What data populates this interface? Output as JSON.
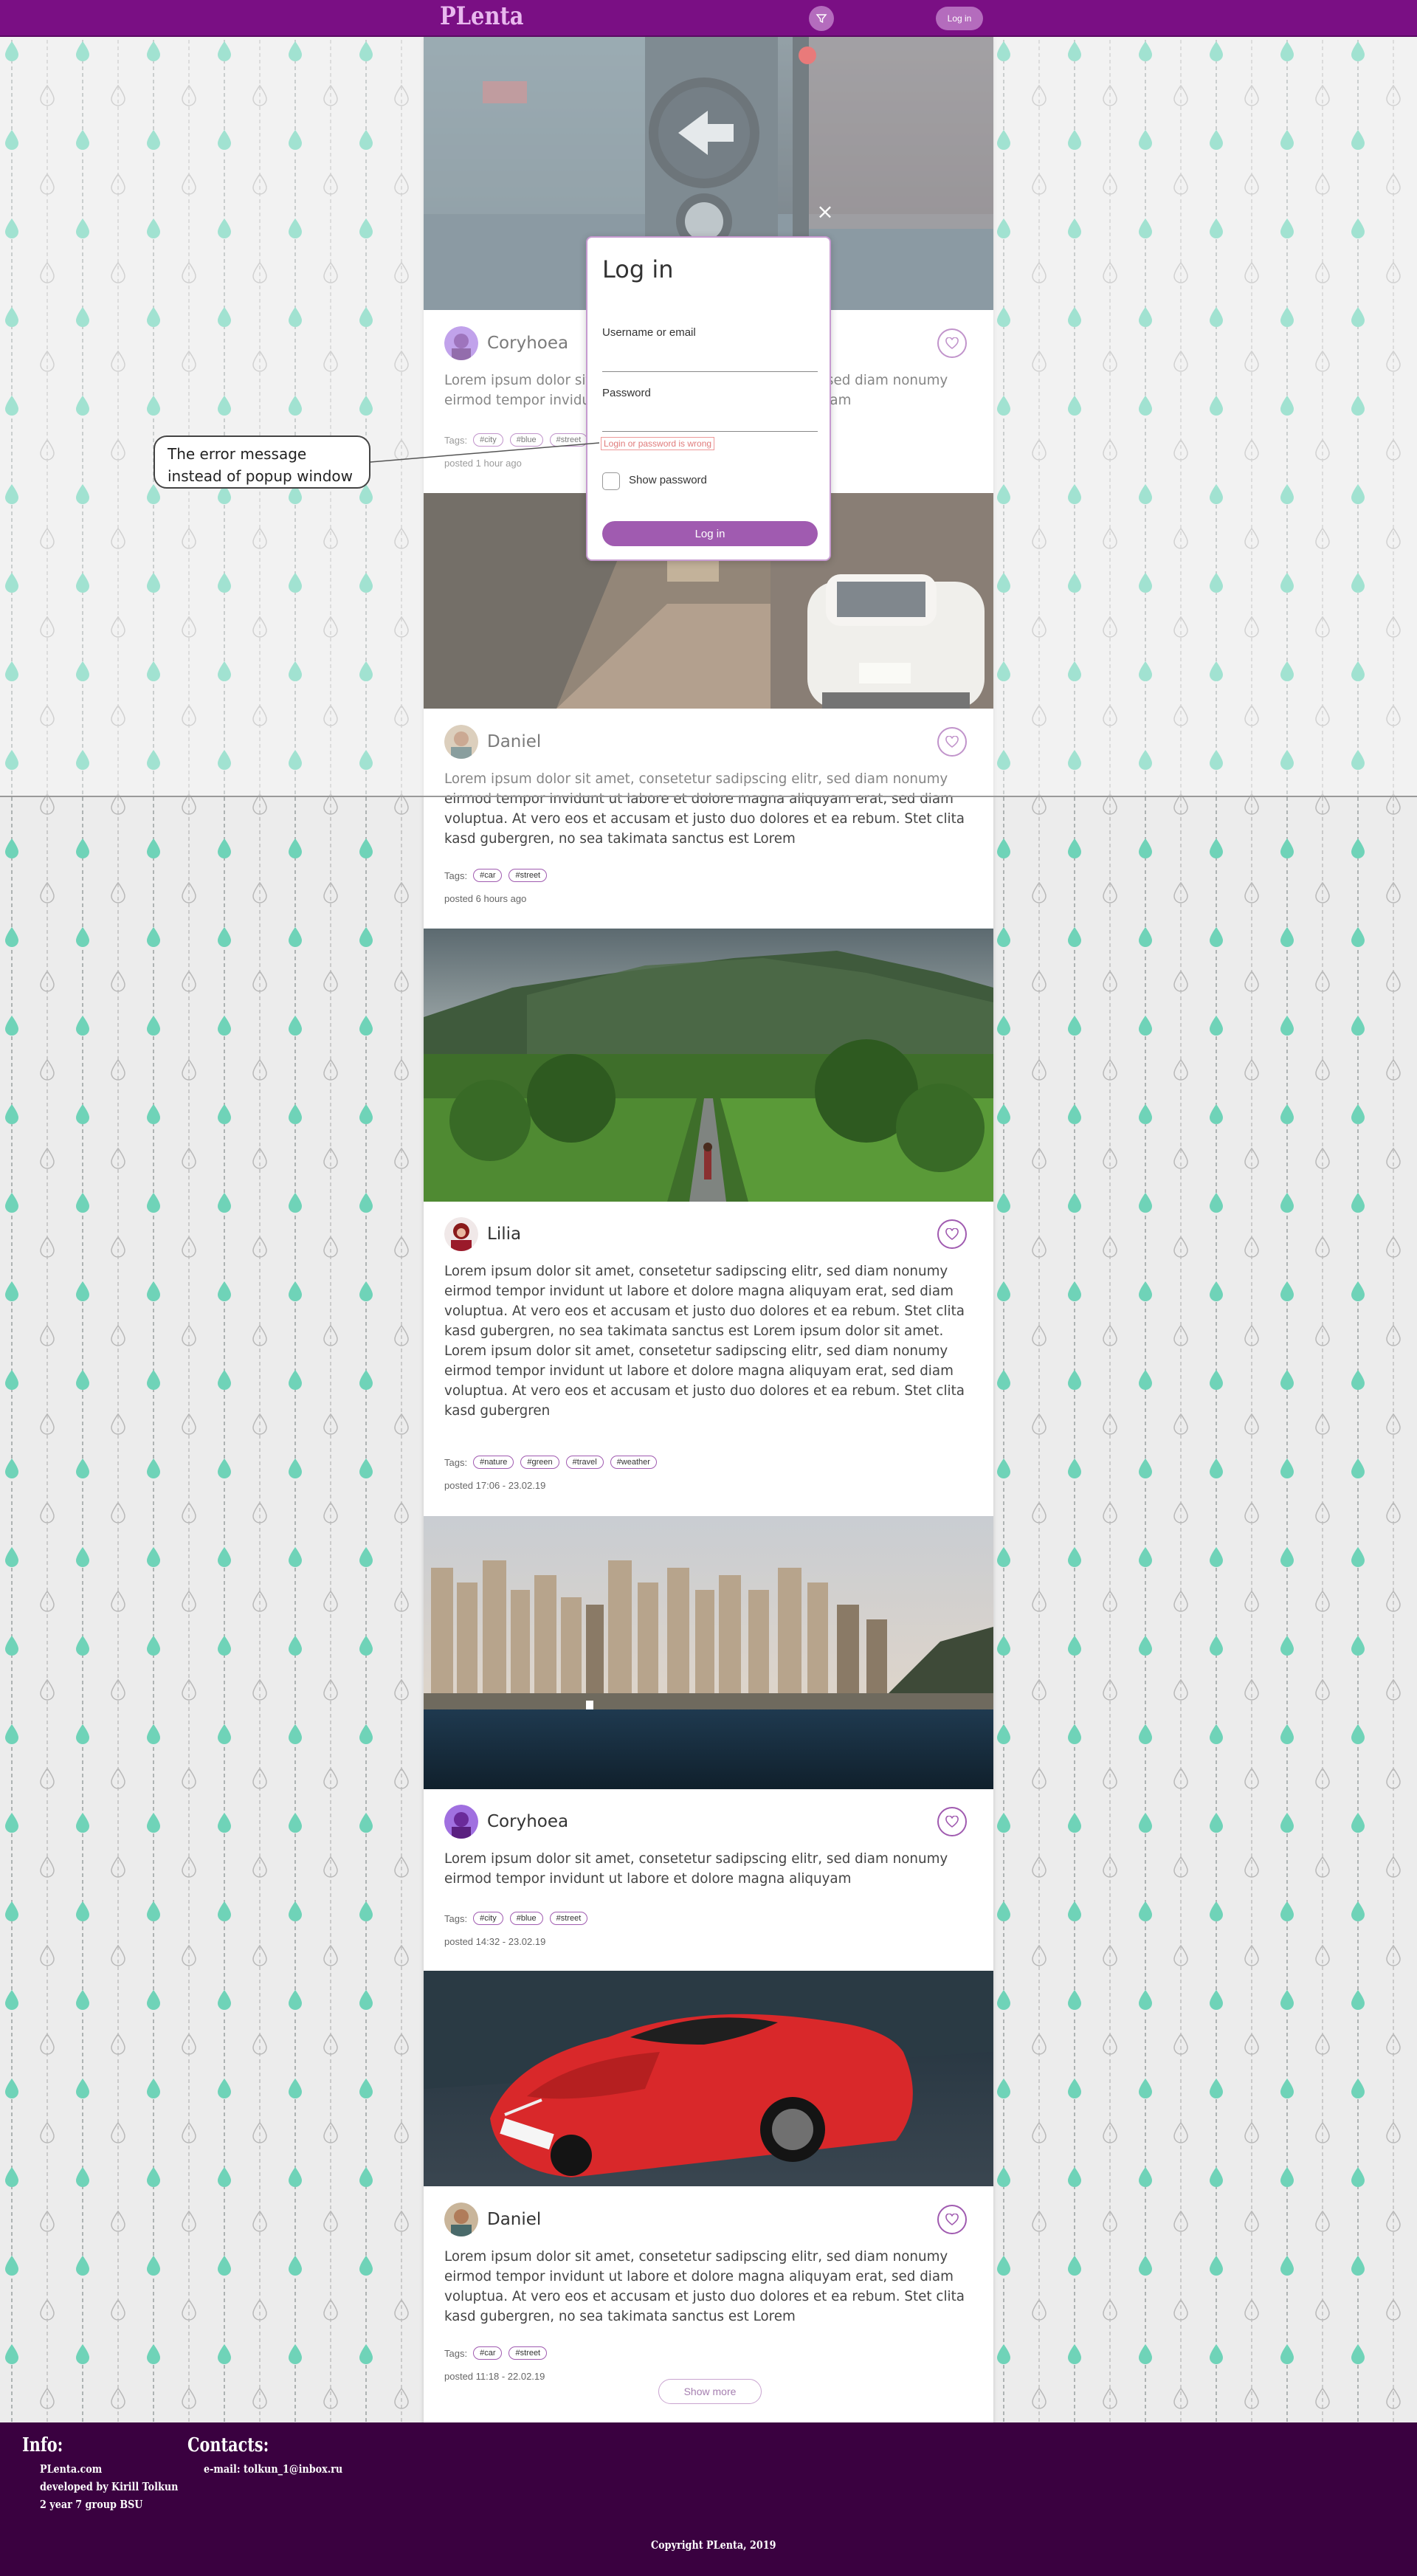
{
  "header": {
    "logo": "PLenta",
    "login_label": "Log in",
    "filter_icon": "filter-funnel-icon"
  },
  "login_modal": {
    "close_label": "×",
    "title": "Log in",
    "username_label": "Username or email",
    "username_value": "",
    "password_label": "Password",
    "password_value": "",
    "error": "Login or password is wrong",
    "show_password_label": "Show password",
    "submit_label": "Log in"
  },
  "annotation": {
    "line1": "The error message",
    "line2": "instead of popup window"
  },
  "posts": [
    {
      "photo": "street-traffic-light",
      "author": "Coryhoea",
      "text": "Lorem ipsum dolor sit amet, consetetur sadipscing elitr, sed diam nonumy eirmod tempor invidunt ut labore et dolore magna aliquyam",
      "tags_label": "Tags:",
      "tags": [
        "#city",
        "#blue",
        "#street"
      ],
      "posted": "posted 1 hour ago"
    },
    {
      "photo": "white-car-old-street",
      "author": "Daniel",
      "text": "Lorem ipsum dolor sit amet, consetetur sadipscing elitr, sed diam nonumy eirmod tempor invidunt ut labore et dolore magna aliquyam erat, sed diam voluptua. At vero eos et accusam et justo duo dolores et ea rebum. Stet clita kasd gubergren, no sea takimata sanctus est Lorem",
      "tags_label": "Tags:",
      "tags": [
        "#car",
        "#street"
      ],
      "posted": "posted 6 hours ago"
    },
    {
      "photo": "jungle-road",
      "author": "Lilia",
      "text": "Lorem ipsum dolor sit amet, consetetur sadipscing elitr, sed diam nonumy eirmod tempor invidunt ut labore et dolore magna aliquyam erat, sed diam voluptua. At vero eos et accusam et justo duo dolores et ea rebum. Stet clita kasd gubergren, no sea takimata sanctus est Lorem ipsum dolor sit amet. Lorem ipsum dolor sit amet, consetetur sadipscing elitr, sed diam nonumy eirmod tempor invidunt ut labore et dolore magna aliquyam erat, sed diam voluptua. At vero eos et accusam et justo duo dolores et ea rebum. Stet clita kasd gubergren",
      "tags_label": "Tags:",
      "tags": [
        "#nature",
        "#green",
        "#travel",
        "#weather"
      ],
      "posted": "posted 17:06 - 23.02.19"
    },
    {
      "photo": "city-waterfront",
      "author": "Coryhoea",
      "text": "Lorem ipsum dolor sit amet, consetetur sadipscing elitr, sed diam nonumy eirmod tempor invidunt ut labore et dolore magna aliquyam",
      "tags_label": "Tags:",
      "tags": [
        "#city",
        "#blue",
        "#street"
      ],
      "posted": "posted 14:32 - 23.02.19"
    },
    {
      "photo": "red-sports-car",
      "author": "Daniel",
      "text": "Lorem ipsum dolor sit amet, consetetur sadipscing elitr, sed diam nonumy eirmod tempor invidunt ut labore et dolore magna aliquyam erat, sed diam voluptua. At vero eos et accusam et justo duo dolores et ea rebum. Stet clita kasd gubergren, no sea takimata sanctus est Lorem",
      "tags_label": "Tags:",
      "tags": [
        "#car",
        "#street"
      ],
      "posted": "posted 11:18 - 22.02.19"
    }
  ],
  "show_more": "Show more",
  "footer": {
    "info_title": "Info:",
    "info_lines": [
      "PLenta.com",
      "developed by Kirill Tolkun",
      "2 year 7 group BSU"
    ],
    "contacts_title": "Contacts:",
    "contacts_lines": [
      "e-mail: tolkun_1@inbox.ru"
    ],
    "copyright": "Copyright PLenta, 2019"
  },
  "colors": {
    "header": "#7a0f84",
    "accent": "#a05bb0",
    "footer": "#3a0140",
    "drop_filled": "#6fd3b8",
    "error": "#e07b7b"
  }
}
